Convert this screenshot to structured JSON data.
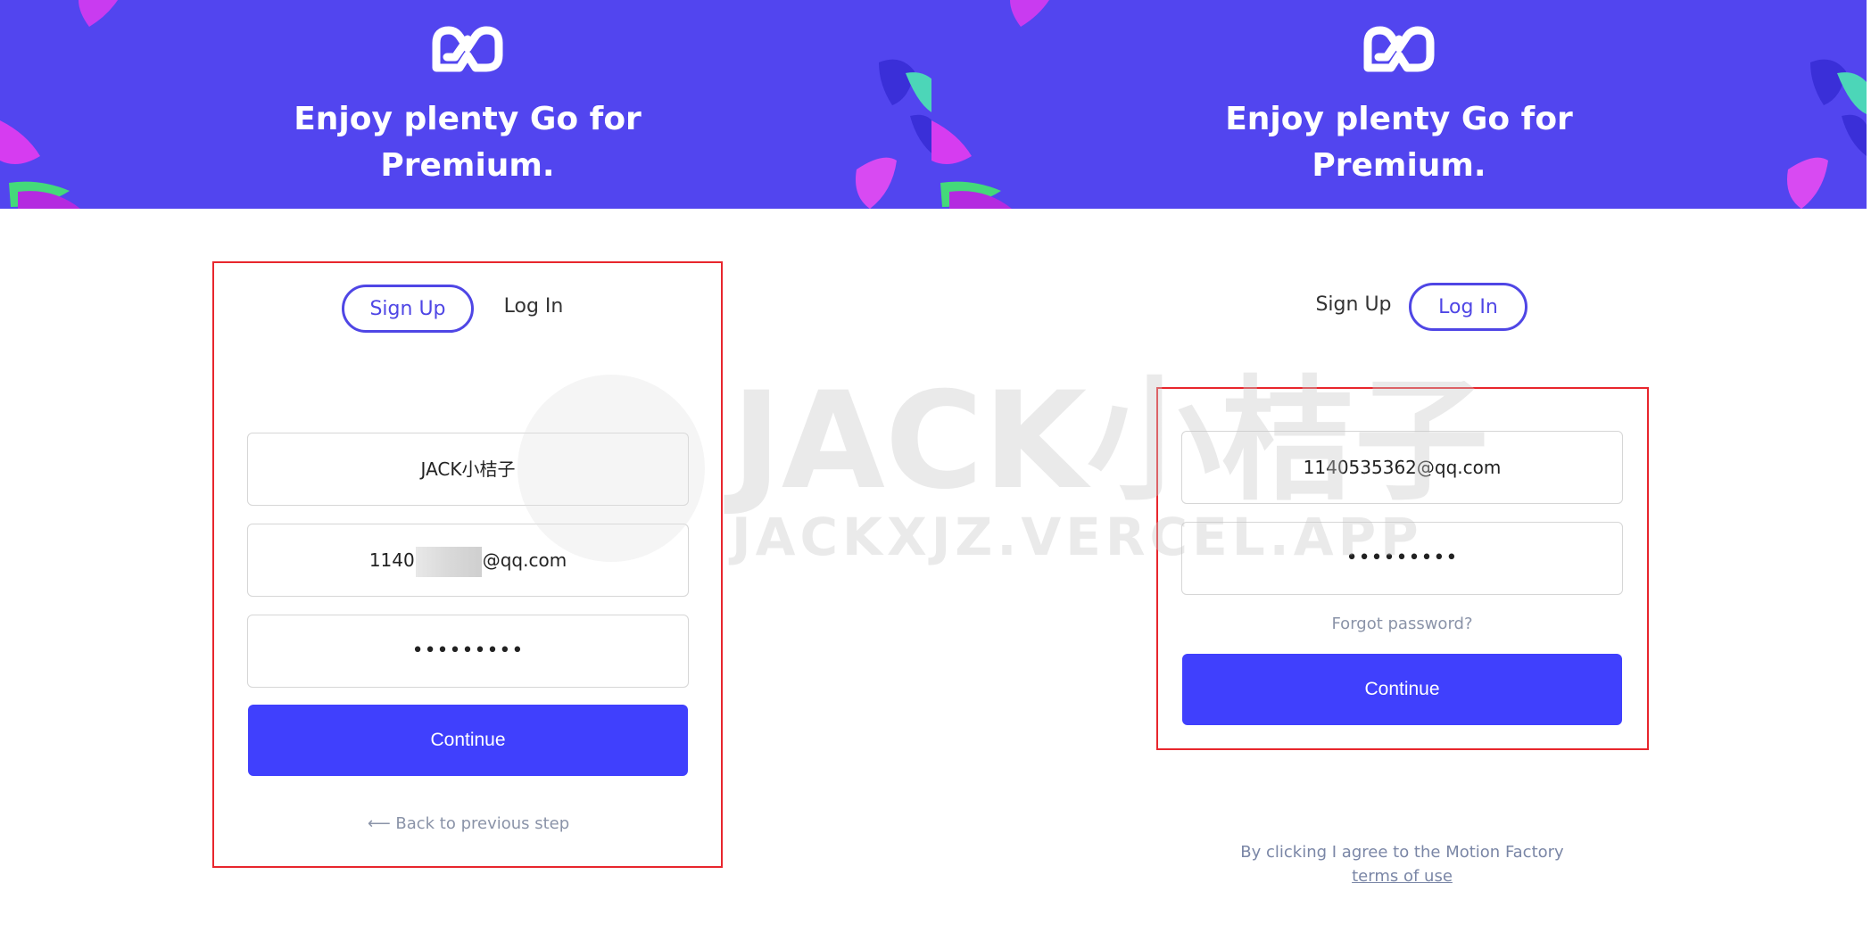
{
  "banner": {
    "title_line1": "Enjoy plenty Go for",
    "title_line2": "Premium.",
    "background": "#5245ef",
    "logo_icon": "motion-logo-icon"
  },
  "signup_panel": {
    "tabs": [
      {
        "label": "Sign Up",
        "active": true
      },
      {
        "label": "Log In",
        "active": false
      }
    ],
    "fields": {
      "username": "JACK小桔子",
      "email_prefix": "1140",
      "email_suffix": "@qq.com",
      "password": "•••••••••"
    },
    "continue_label": "Continue",
    "back_label": "Back to previous step",
    "back_icon": "arrow-left-icon"
  },
  "login_panel": {
    "tabs": [
      {
        "label": "Sign Up",
        "active": false
      },
      {
        "label": "Log In",
        "active": true
      }
    ],
    "fields": {
      "email": "1140535362@qq.com",
      "password": "•••••••••"
    },
    "forgot_label": "Forgot password?",
    "continue_label": "Continue",
    "terms_text": "By clicking I agree to the Motion Factory",
    "terms_link": "terms of use"
  },
  "watermark": {
    "title": "JACK小桔子",
    "url": "JACKXJZ.VERCEL.APP"
  },
  "colors": {
    "accent": "#4f46e5",
    "button": "#4040fd",
    "highlight": "#e8262d",
    "muted_text": "#8a93a8"
  }
}
